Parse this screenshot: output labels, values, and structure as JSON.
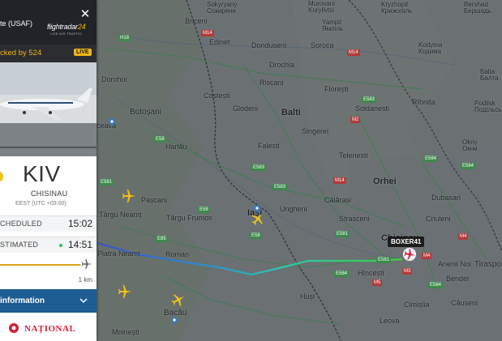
{
  "panel": {
    "aircraft_name": "te (USAF)",
    "logo_text": "flightradar",
    "logo_number": "24",
    "logo_subtitle": "LIVE AIR TRAFFIC",
    "close_label": "✕",
    "tracked_text": "cked by 524",
    "live_label": "LIVE",
    "expand_label": "⤢",
    "destination": {
      "code": "KIV",
      "city": "CHISINAU",
      "timezone": "EEST (UTC +03:00)"
    },
    "scheduled": {
      "label": "CHEDULED",
      "time": "15:02"
    },
    "estimated": {
      "label": "STIMATED",
      "time": "14:51"
    },
    "progress_fraction": 0.99,
    "distance_remaining": "1 km",
    "info_label": "information",
    "brand": "NAȚIONAL",
    "colors": {
      "accent": "#f1b51a",
      "info_bar": "#1e5d93",
      "brand": "#d0213a",
      "on_time_dot": "#2ebd5f"
    }
  },
  "map": {
    "callsign": "BOXER41",
    "places": [
      {
        "name": "Sokyryany\nСокиряни",
        "cls": "small"
      },
      {
        "name": "Murovani\nKurylivtsi",
        "cls": "small"
      },
      {
        "name": "Kryzhopil\nКрижопіль",
        "cls": "small"
      },
      {
        "name": "Bershad\nБершадь",
        "cls": "small"
      },
      {
        "name": "Yampil\nЯмпіль",
        "cls": "small"
      },
      {
        "name": "Briceni",
        "cls": "small"
      },
      {
        "name": "Edinet",
        "cls": "small"
      },
      {
        "name": "Donduseni",
        "cls": "small"
      },
      {
        "name": "Soroca",
        "cls": "small"
      },
      {
        "name": "Kodyma\nКодима",
        "cls": "small"
      },
      {
        "name": "Drochia",
        "cls": "small"
      },
      {
        "name": "Balta\nБалта",
        "cls": "small"
      },
      {
        "name": "Dorohoi",
        "cls": "small"
      },
      {
        "name": "Riscani",
        "cls": "small"
      },
      {
        "name": "Florești",
        "cls": "small"
      },
      {
        "name": "Costești",
        "cls": "small"
      },
      {
        "name": "Glodeni",
        "cls": "small"
      },
      {
        "name": "Balti",
        "cls": "big"
      },
      {
        "name": "Soldanesti",
        "cls": "small"
      },
      {
        "name": "Rîbnița",
        "cls": "small"
      },
      {
        "name": "Podilsk\nПодільськ",
        "cls": "small"
      },
      {
        "name": "Botoșani",
        "cls": "mid"
      },
      {
        "name": "Singerei",
        "cls": "small"
      },
      {
        "name": "Suceava",
        "cls": "small"
      },
      {
        "name": "Falesti",
        "cls": "small"
      },
      {
        "name": "Telenesti",
        "cls": "small"
      },
      {
        "name": "Okny\nОкни",
        "cls": "small"
      },
      {
        "name": "Harlău",
        "cls": "small"
      },
      {
        "name": "Orhei",
        "cls": "small"
      },
      {
        "name": "Dubasari",
        "cls": "small"
      },
      {
        "name": "Pașcani",
        "cls": "small"
      },
      {
        "name": "Ungheni",
        "cls": "small"
      },
      {
        "name": "Călărași",
        "cls": "small"
      },
      {
        "name": "Criuleni",
        "cls": "small"
      },
      {
        "name": "Târgu Neamț",
        "cls": "small"
      },
      {
        "name": "Târgu Frumos",
        "cls": "small"
      },
      {
        "name": "Iași",
        "cls": "big"
      },
      {
        "name": "Strasceni",
        "cls": "small"
      },
      {
        "name": "Chisinau",
        "cls": "big"
      },
      {
        "name": "Piatra Neamț",
        "cls": "small"
      },
      {
        "name": "Roman",
        "cls": "small"
      },
      {
        "name": "Hîncești",
        "cls": "small"
      },
      {
        "name": "Anenii Noi",
        "cls": "small"
      },
      {
        "name": "Tiraspol",
        "cls": "mid"
      },
      {
        "name": "Bender",
        "cls": "small"
      },
      {
        "name": "Huși",
        "cls": "small"
      },
      {
        "name": "Bacău",
        "cls": "mid"
      },
      {
        "name": "Leova",
        "cls": "small"
      },
      {
        "name": "Moinești",
        "cls": "small"
      },
      {
        "name": "Cimișlia",
        "cls": "small"
      },
      {
        "name": "Căușeni",
        "cls": "small"
      }
    ],
    "roads": [
      "H18",
      "M14",
      "M14",
      "E583",
      "M2",
      "E584",
      "E583",
      "M14",
      "E58",
      "E58",
      "E581",
      "E85",
      "E583",
      "M4",
      "E584",
      "E581",
      "M3",
      "E581",
      "E58",
      "M4",
      "E584",
      "M5",
      "E584"
    ]
  }
}
